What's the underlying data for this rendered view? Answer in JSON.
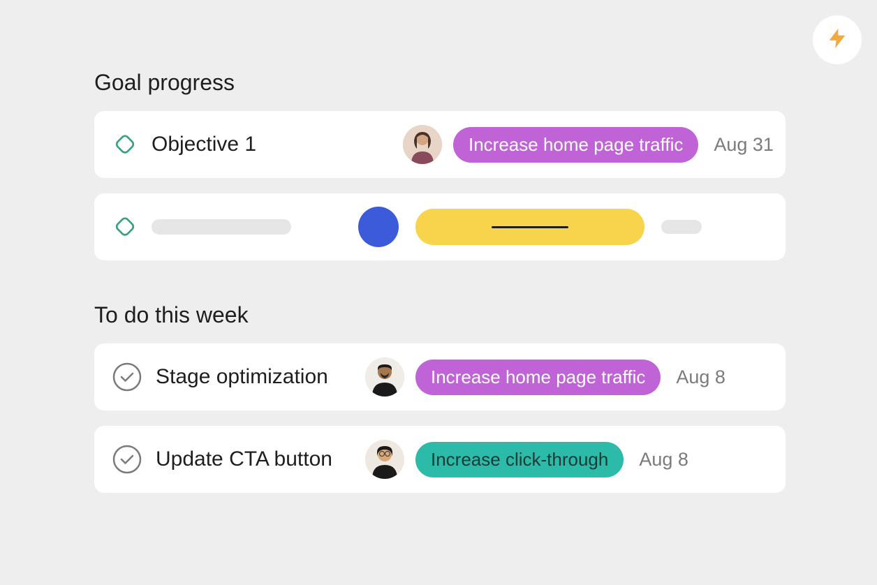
{
  "colors": {
    "background": "#eeeeee",
    "card": "#ffffff",
    "text_primary": "#1e1e1e",
    "text_muted": "#7b7b7b",
    "tag_purple": "#bf63d6",
    "tag_teal": "#2bbba8",
    "accent_blue": "#3b5bdb",
    "accent_yellow": "#f8d44c",
    "skeleton": "#e6e6e6",
    "diamond_stroke": "#3aa17e",
    "check_stroke": "#7b7b7b",
    "lightning": "#f3a93c"
  },
  "icons": {
    "lightning": "lightning-icon",
    "diamond": "diamond-icon",
    "check_circle": "check-circle-icon"
  },
  "sections": {
    "goals": {
      "title": "Goal progress",
      "items": [
        {
          "title": "Objective 1",
          "tag": {
            "label": "Increase home page traffic",
            "color": "purple"
          },
          "date": "Aug 31"
        }
      ]
    },
    "todos": {
      "title": "To do this week",
      "items": [
        {
          "title": "Stage optimization",
          "tag": {
            "label": "Increase home page traffic",
            "color": "purple"
          },
          "date": "Aug 8"
        },
        {
          "title": "Update CTA button",
          "tag": {
            "label": "Increase click-through",
            "color": "teal"
          },
          "date": "Aug 8"
        }
      ]
    }
  }
}
